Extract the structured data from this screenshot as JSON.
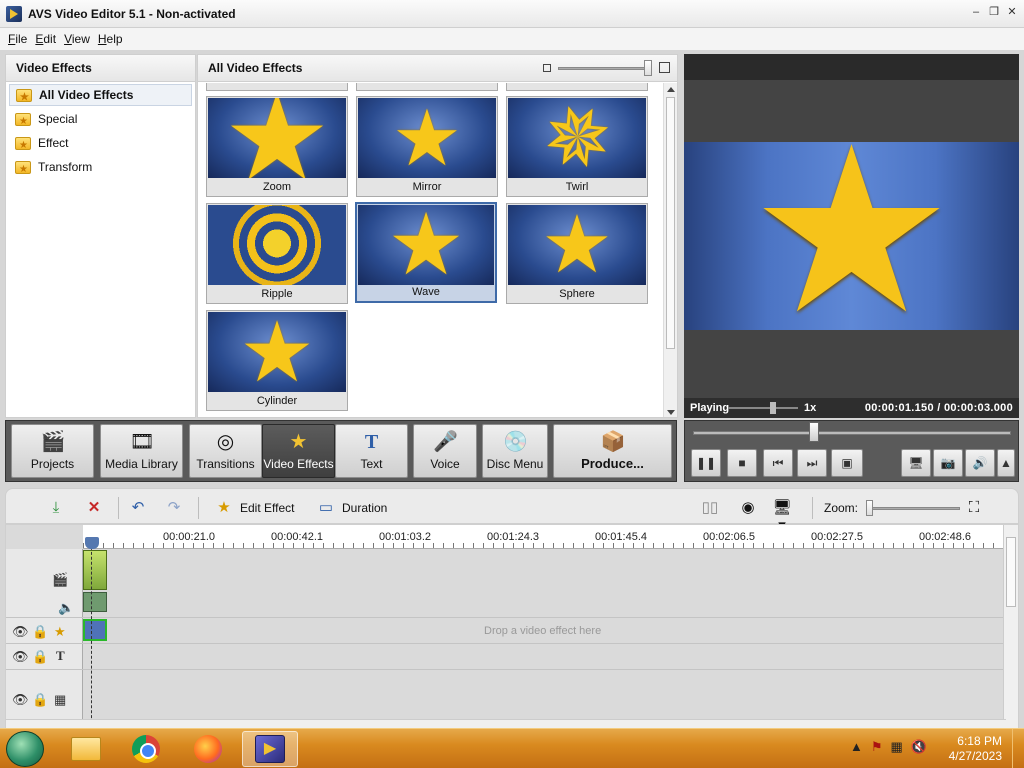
{
  "window": {
    "title": "AVS Video Editor 5.1 - Non-activated",
    "controls": {
      "minimize": "–",
      "restore": "❐",
      "close": "✕"
    }
  },
  "menu": [
    "File",
    "Edit",
    "View",
    "Help"
  ],
  "left_panel": {
    "title": "Video Effects",
    "items": [
      {
        "label": "All Video Effects",
        "selected": true
      },
      {
        "label": "Special"
      },
      {
        "label": "Effect"
      },
      {
        "label": "Transform"
      }
    ]
  },
  "effects_panel": {
    "title": "All Video Effects",
    "effects": [
      {
        "label": "Zoom"
      },
      {
        "label": "Mirror"
      },
      {
        "label": "Twirl"
      },
      {
        "label": "Ripple"
      },
      {
        "label": "Wave",
        "selected": true
      },
      {
        "label": "Sphere"
      },
      {
        "label": "Cylinder"
      }
    ]
  },
  "preview": {
    "status": "Playing",
    "speed": "1x",
    "timecode": "00:00:01.150  /  00:00:03.000"
  },
  "toolbar": {
    "buttons": [
      {
        "label": "Projects",
        "icon": "clapperboard-icon"
      },
      {
        "label": "Media Library",
        "icon": "film-icon"
      },
      {
        "label": "Transitions",
        "icon": "transition-icon"
      },
      {
        "label": "Video Effects",
        "icon": "effects-star-icon",
        "active": true
      },
      {
        "label": "Text",
        "icon": "text-t-icon"
      },
      {
        "label": "Voice",
        "icon": "microphone-icon"
      },
      {
        "label": "Disc Menu",
        "icon": "disc-icon"
      },
      {
        "label": "Produce...",
        "icon": "produce-icon"
      }
    ]
  },
  "playback": {
    "buttons": [
      "pause-icon",
      "stop-icon",
      "previous-frame-icon",
      "next-frame-icon",
      "fullscreen-icon"
    ],
    "extra_buttons": [
      "monitor-icon",
      "camera-icon",
      "volume-icon",
      "expand-arrow-icon"
    ]
  },
  "timeline_bar": {
    "edit_effect_label": "Edit Effect",
    "duration_label": "Duration",
    "zoom_label": "Zoom:"
  },
  "timeline": {
    "ticks": [
      "00:00:21.0",
      "00:00:42.1",
      "00:01:03.2",
      "00:01:24.3",
      "00:01:45.4",
      "00:02:06.5",
      "00:02:27.5",
      "00:02:48.6"
    ],
    "drop_hint": "Drop a video effect here"
  },
  "taskbar": {
    "time": "6:18 PM",
    "date": "4/27/2023"
  }
}
